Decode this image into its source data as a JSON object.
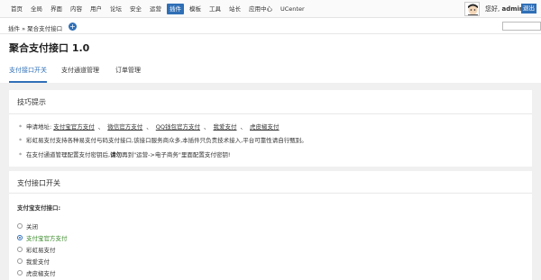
{
  "nav": {
    "items": [
      "首页",
      "全局",
      "界面",
      "内容",
      "用户",
      "论坛",
      "安全",
      "运营",
      "插件",
      "模板",
      "工具",
      "站长",
      "应用中心",
      "UCenter"
    ],
    "active_index": 8
  },
  "user": {
    "greeting": "您好,",
    "name": "admin",
    "logout": "退出"
  },
  "breadcrumb": {
    "text": "插件 » 聚合支付接口",
    "add_icon": "+"
  },
  "page": {
    "title": "聚合支付接口 1.0"
  },
  "tabs": [
    "支付接口开关",
    "支付通道管理",
    "订单管理"
  ],
  "tips": {
    "title": "技巧提示",
    "apply_label": "申请地址:",
    "apply_links": [
      "支付宝官方支付",
      "微信官方支付",
      "QQ钱包官方支付",
      "我爱支付",
      "虎皮椒支付"
    ],
    "separator": "、",
    "line2": "彩虹易支付支持各种易支付与码支付接口,该接口服务商众多,本插件只负责技术接入,平台可靠性请自行甄别。",
    "line3_pre": "在支付通道管理配置支付密钥后,",
    "line3_bold": "请勿",
    "line3_post": "再到\"运营->电子商务\"里面配置支付密钥!"
  },
  "switch": {
    "title": "支付接口开关",
    "label": "支付宝支付接口:",
    "options": [
      "关闭",
      "支付宝官方支付",
      "彩虹易支付",
      "我爱支付",
      "虎皮椒支付"
    ],
    "selected_index": 1
  },
  "colors": {
    "accent": "#2f6fb6",
    "selected_text": "#3b8a2b",
    "band": "#f0f0f0"
  }
}
